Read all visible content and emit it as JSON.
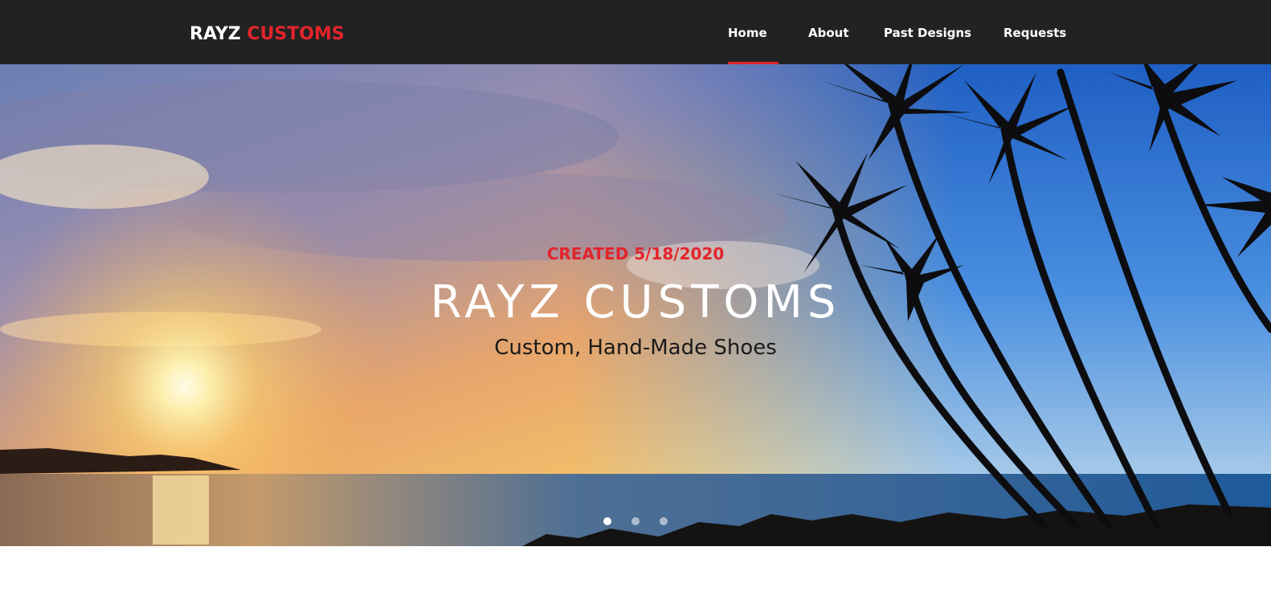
{
  "brand": {
    "part1": "RAYZ",
    "part2": "CUSTOMS",
    "accent_color": "#e3242b"
  },
  "nav": {
    "items": [
      {
        "label": "Home",
        "active": true
      },
      {
        "label": "About",
        "active": false
      },
      {
        "label": "Past Designs",
        "active": false
      },
      {
        "label": "Requests",
        "active": false
      }
    ]
  },
  "hero": {
    "eyebrow": "CREATED 5/18/2020",
    "title": "RAYZ CUSTOMS",
    "subtitle": "Custom, Hand-Made Shoes",
    "background": "sunset-beach-palm-trees",
    "slides_count": 3,
    "active_slide": 1
  }
}
